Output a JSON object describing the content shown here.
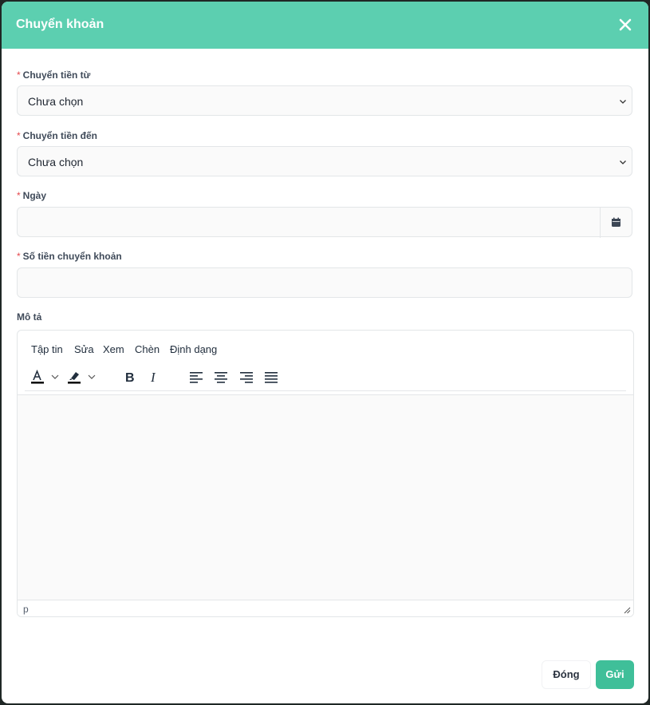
{
  "dialog": {
    "title": "Chuyển khoản"
  },
  "form": {
    "from": {
      "label": "Chuyển tiền từ",
      "value": "Chưa chọn"
    },
    "to": {
      "label": "Chuyển tiền đến",
      "value": "Chưa chọn"
    },
    "date": {
      "label": "Ngày",
      "value": ""
    },
    "amount": {
      "label": "Số tiền chuyển khoản",
      "value": ""
    },
    "description": {
      "label": "Mô tả"
    }
  },
  "editor": {
    "menu": [
      "Tập tin",
      "Sửa",
      "Xem",
      "Chèn",
      "Định dạng"
    ],
    "status_path": "p"
  },
  "footer": {
    "close_label": "Đóng",
    "send_label": "Gửi"
  },
  "colors": {
    "header": "#5ccfb0",
    "primary_button": "#3fbf99",
    "required_mark": "#e5484d"
  }
}
